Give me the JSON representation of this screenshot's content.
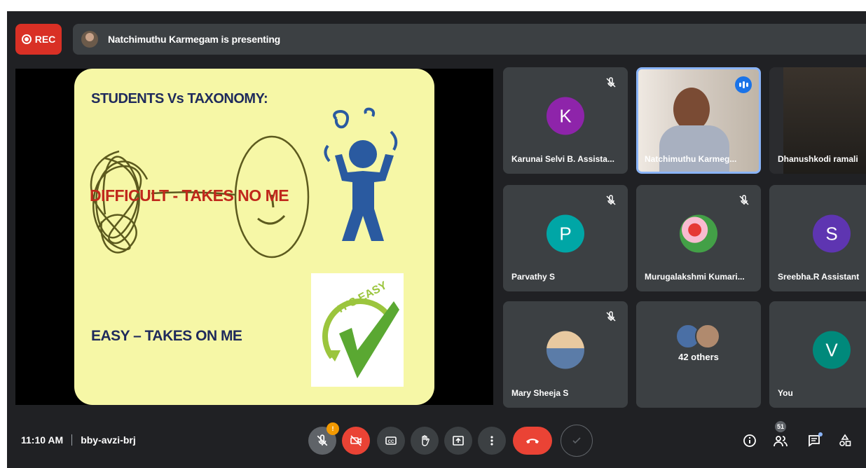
{
  "topbar": {
    "rec_label": "REC",
    "presenting_text": "Natchimuthu Karmegam is presenting"
  },
  "slide": {
    "title": "STUDENTS Vs TAXONOMY:",
    "difficult": "DIFFICULT - TAKES NO ME",
    "easy": "EASY – TAKES ON ME",
    "badge_text": "IT'S EASY",
    "colors": {
      "background": "#f6f7a6",
      "text": "#1f2a5c",
      "accent": "#c0281c"
    }
  },
  "participants": [
    {
      "name": "Karunai Selvi B. Assista...",
      "initial": "K",
      "color": "#8e24aa",
      "muted": true
    },
    {
      "name": "Natchimuthu Karmeg...",
      "speaking": true
    },
    {
      "name": "Dhanushkodi ramali"
    },
    {
      "name": "Parvathy S",
      "initial": "P",
      "color": "#00a6a6",
      "muted": true
    },
    {
      "name": "Murugalakshmi Kumari...",
      "muted": true
    },
    {
      "name": "Sreebha.R Assistant",
      "initial": "S",
      "color": "#5e35b1"
    },
    {
      "name": "Mary Sheeja S",
      "muted": true
    },
    {
      "others_label": "42 others"
    },
    {
      "name": "You",
      "initial": "V",
      "color": "#00897b"
    }
  ],
  "bottombar": {
    "time": "11:10 AM",
    "meeting_code": "bby-avzi-brj",
    "mic_alert": "!",
    "people_count": "51"
  },
  "icons": [
    "record-icon",
    "mic-off-icon",
    "camera-off-icon",
    "captions-icon",
    "raise-hand-icon",
    "present-icon",
    "more-options-icon",
    "end-call-icon",
    "info-icon",
    "people-icon",
    "chat-icon",
    "activities-icon"
  ]
}
